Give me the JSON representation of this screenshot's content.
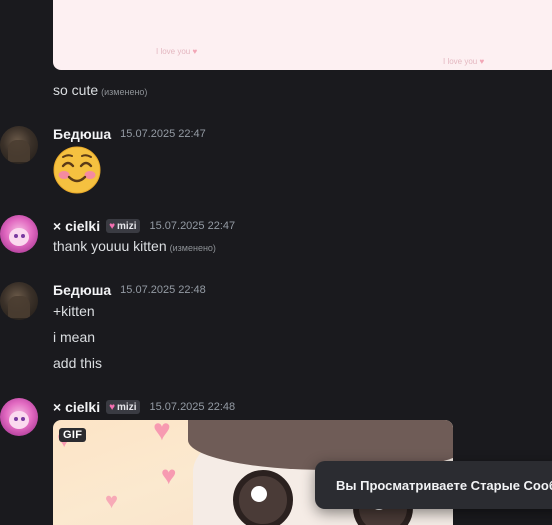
{
  "previous_embed": {
    "watermark_1": "I love you",
    "watermark_2": "I love you"
  },
  "messages": [
    {
      "text": "so cute",
      "edited": "(изменено)"
    }
  ],
  "groups": [
    {
      "author": "Бедюша",
      "timestamp": "15.07.2025 22:47",
      "emoji": "smiling-face-with-smiling-eyes-icon"
    },
    {
      "author": "× cielki",
      "tag": "mizi",
      "timestamp": "15.07.2025 22:47",
      "lines": [
        {
          "text": "thank youuu kitten",
          "edited": "(изменено)"
        }
      ]
    },
    {
      "author": "Бедюша",
      "timestamp": "15.07.2025 22:48",
      "lines": [
        {
          "text": "+kitten"
        },
        {
          "text": "i mean"
        },
        {
          "text": "add this"
        }
      ]
    },
    {
      "author": "× cielki",
      "tag": "mizi",
      "timestamp": "15.07.2025 22:48",
      "gif_badge": "GIF"
    }
  ],
  "toast": {
    "text": "Вы Просматриваете Старые Сообщения"
  },
  "colors": {
    "background": "#1a1a1e",
    "toast_bg": "#2b2c31",
    "tag_heart": "#f46fb1"
  }
}
